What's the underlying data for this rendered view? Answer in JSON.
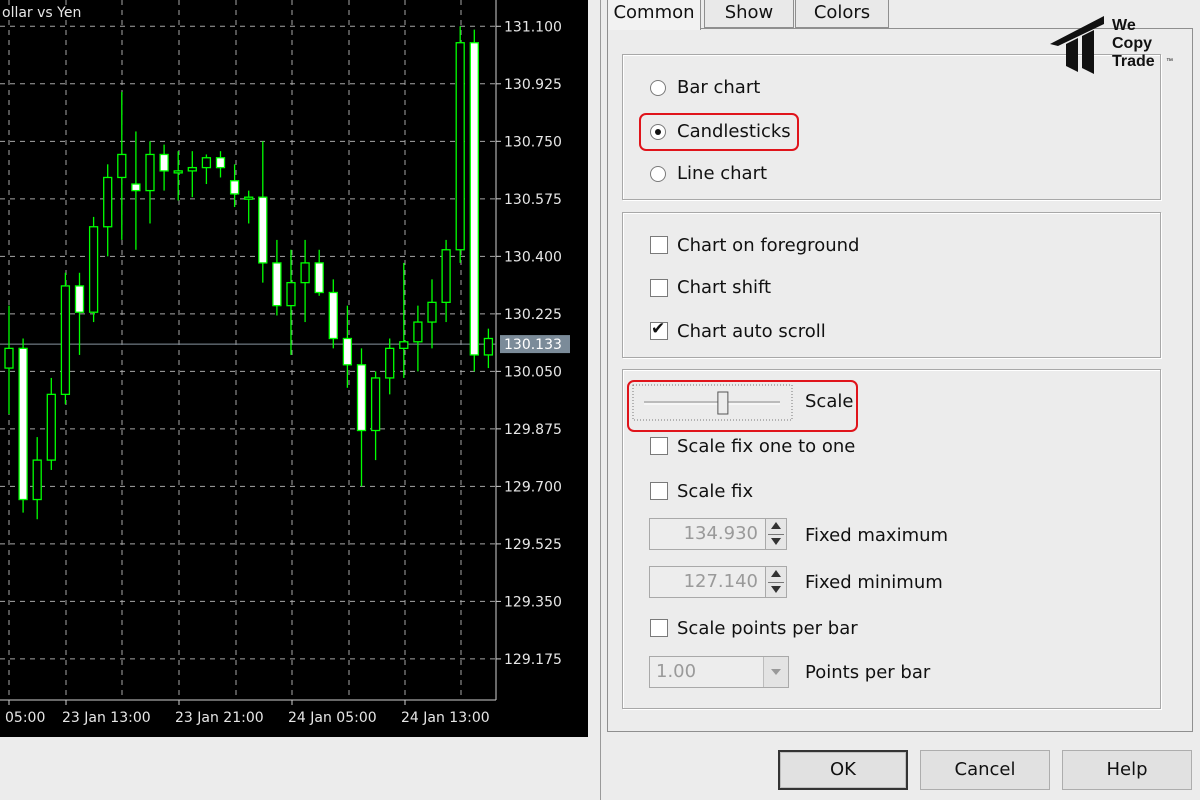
{
  "chart": {
    "title": "ollar vs Yen",
    "price_labels": [
      "131.100",
      "130.925",
      "130.750",
      "130.575",
      "130.400",
      "130.225",
      "130.050",
      "129.875",
      "129.700",
      "129.525",
      "129.350",
      "129.175"
    ],
    "current_price": "130.133",
    "time_labels": [
      "05:00",
      "23 Jan 13:00",
      "23 Jan 21:00",
      "24 Jan 05:00",
      "24 Jan 13:00"
    ],
    "colors": {
      "background": "#000000",
      "grid": "#a6a6a6",
      "candle": "#00ff00",
      "bull_fill": "#000000",
      "bear_fill": "#ffffff",
      "price_tag": "#7b8b99"
    }
  },
  "chart_data": {
    "type": "candlestick",
    "ylim": [
      129.05,
      131.18
    ],
    "candles": [
      {
        "o": 130.06,
        "h": 130.25,
        "l": 129.92,
        "c": 130.12
      },
      {
        "o": 130.12,
        "h": 130.15,
        "l": 129.62,
        "c": 129.66
      },
      {
        "o": 129.66,
        "h": 129.85,
        "l": 129.6,
        "c": 129.78
      },
      {
        "o": 129.78,
        "h": 130.03,
        "l": 129.75,
        "c": 129.98
      },
      {
        "o": 129.98,
        "h": 130.35,
        "l": 129.95,
        "c": 130.31
      },
      {
        "o": 130.31,
        "h": 130.35,
        "l": 130.1,
        "c": 130.23
      },
      {
        "o": 130.23,
        "h": 130.52,
        "l": 130.2,
        "c": 130.49
      },
      {
        "o": 130.49,
        "h": 130.68,
        "l": 130.4,
        "c": 130.64
      },
      {
        "o": 130.64,
        "h": 130.9,
        "l": 130.45,
        "c": 130.71
      },
      {
        "o": 130.62,
        "h": 130.78,
        "l": 130.42,
        "c": 130.6
      },
      {
        "o": 130.6,
        "h": 130.75,
        "l": 130.5,
        "c": 130.71
      },
      {
        "o": 130.71,
        "h": 130.74,
        "l": 130.6,
        "c": 130.66
      },
      {
        "o": 130.66,
        "h": 130.72,
        "l": 130.57,
        "c": 130.66
      },
      {
        "o": 130.66,
        "h": 130.72,
        "l": 130.58,
        "c": 130.67
      },
      {
        "o": 130.67,
        "h": 130.71,
        "l": 130.62,
        "c": 130.7
      },
      {
        "o": 130.7,
        "h": 130.72,
        "l": 130.64,
        "c": 130.67
      },
      {
        "o": 130.63,
        "h": 130.68,
        "l": 130.55,
        "c": 130.59
      },
      {
        "o": 130.58,
        "h": 130.6,
        "l": 130.5,
        "c": 130.58
      },
      {
        "o": 130.58,
        "h": 130.75,
        "l": 130.32,
        "c": 130.38
      },
      {
        "o": 130.38,
        "h": 130.45,
        "l": 130.22,
        "c": 130.25
      },
      {
        "o": 130.25,
        "h": 130.42,
        "l": 130.1,
        "c": 130.32
      },
      {
        "o": 130.32,
        "h": 130.45,
        "l": 130.2,
        "c": 130.38
      },
      {
        "o": 130.38,
        "h": 130.42,
        "l": 130.28,
        "c": 130.29
      },
      {
        "o": 130.29,
        "h": 130.33,
        "l": 130.12,
        "c": 130.15
      },
      {
        "o": 130.15,
        "h": 130.25,
        "l": 130.0,
        "c": 130.07
      },
      {
        "o": 130.07,
        "h": 130.12,
        "l": 129.7,
        "c": 129.87
      },
      {
        "o": 129.87,
        "h": 130.05,
        "l": 129.78,
        "c": 130.03
      },
      {
        "o": 130.03,
        "h": 130.15,
        "l": 129.98,
        "c": 130.12
      },
      {
        "o": 130.12,
        "h": 130.38,
        "l": 130.03,
        "c": 130.14
      },
      {
        "o": 130.14,
        "h": 130.25,
        "l": 130.05,
        "c": 130.2
      },
      {
        "o": 130.2,
        "h": 130.33,
        "l": 130.12,
        "c": 130.26
      },
      {
        "o": 130.26,
        "h": 130.45,
        "l": 130.2,
        "c": 130.42
      },
      {
        "o": 130.42,
        "h": 131.1,
        "l": 130.38,
        "c": 131.05
      },
      {
        "o": 131.05,
        "h": 131.09,
        "l": 130.05,
        "c": 130.1
      },
      {
        "o": 130.1,
        "h": 130.18,
        "l": 130.06,
        "c": 130.15
      }
    ]
  },
  "dialog": {
    "tabs": [
      "Common",
      "Show",
      "Colors"
    ],
    "chart_type": {
      "options": [
        "Bar chart",
        "Candlesticks",
        "Line chart"
      ],
      "selected": "Candlesticks"
    },
    "options_group": [
      {
        "label": "Chart on foreground",
        "checked": false
      },
      {
        "label": "Chart shift",
        "checked": false
      },
      {
        "label": "Chart auto scroll",
        "checked": true
      }
    ],
    "scale": {
      "label": "Scale",
      "level": 0.58,
      "fix_one_to_one": "Scale fix one to one",
      "fix": "Scale fix",
      "fixed_max_value": "134.930",
      "fixed_max_label": "Fixed maximum",
      "fixed_min_value": "127.140",
      "fixed_min_label": "Fixed minimum",
      "points_per_bar_check": "Scale points per bar",
      "points_value": "1.00",
      "points_label": "Points per bar"
    },
    "buttons": {
      "ok": "OK",
      "cancel": "Cancel",
      "help": "Help"
    }
  },
  "logo": {
    "line1": "We",
    "line2": "Copy",
    "line3": "Trade",
    "tm": "™"
  },
  "highlight_color": "#e0141b",
  "checkmark": "✔"
}
